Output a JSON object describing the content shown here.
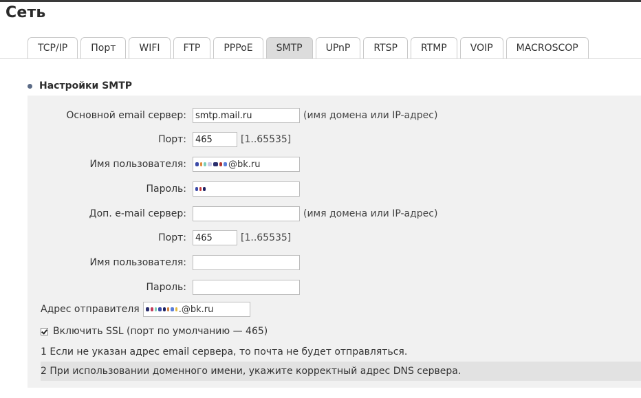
{
  "page_title": "Сеть",
  "tabs": [
    {
      "label": "TCP/IP",
      "active": false
    },
    {
      "label": "Порт",
      "active": false
    },
    {
      "label": "WIFI",
      "active": false
    },
    {
      "label": "FTP",
      "active": false
    },
    {
      "label": "PPPoE",
      "active": false
    },
    {
      "label": "SMTP",
      "active": true
    },
    {
      "label": "UPnP",
      "active": false
    },
    {
      "label": "RTSP",
      "active": false
    },
    {
      "label": "RTMP",
      "active": false
    },
    {
      "label": "VOIP",
      "active": false
    },
    {
      "label": "MACROSCOP",
      "active": false
    }
  ],
  "section": {
    "title": "Настройки SMTP"
  },
  "primary": {
    "server_label": "Основной email сервер:",
    "server_value": "smtp.mail.ru",
    "server_hint": "(имя домена или IP-адрес)",
    "port_label": "Порт:",
    "port_value": "465",
    "port_hint": "[1..65535]",
    "user_label": "Имя пользователя:",
    "user_value_visible": "@bk.ru",
    "password_label": "Пароль:"
  },
  "secondary": {
    "server_label": "Доп. e-mail сервер:",
    "server_value": "",
    "server_hint": "(имя домена или IP-адрес)",
    "port_label": "Порт:",
    "port_value": "465",
    "port_hint": "[1..65535]",
    "user_label": "Имя пользователя:",
    "user_value": "",
    "password_label": "Пароль:",
    "password_value": ""
  },
  "sender": {
    "label": "Адрес отправителя",
    "value_visible": ".@bk.ru"
  },
  "ssl": {
    "label": "Включить SSL (порт по умолчанию — 465)",
    "checked": true
  },
  "notes": {
    "note1": "1 Если не указан адрес email сервера, то почта не будет отправляться.",
    "note2": "2 При использовании доменного имени, укажите корректный адрес DNS сервера."
  },
  "colors": {
    "panel_bg": "#f1f1f1",
    "active_tab_bg": "#dcdcdc",
    "note_highlight_bg": "#e2e2e2",
    "bullet": "#5b6b86"
  }
}
